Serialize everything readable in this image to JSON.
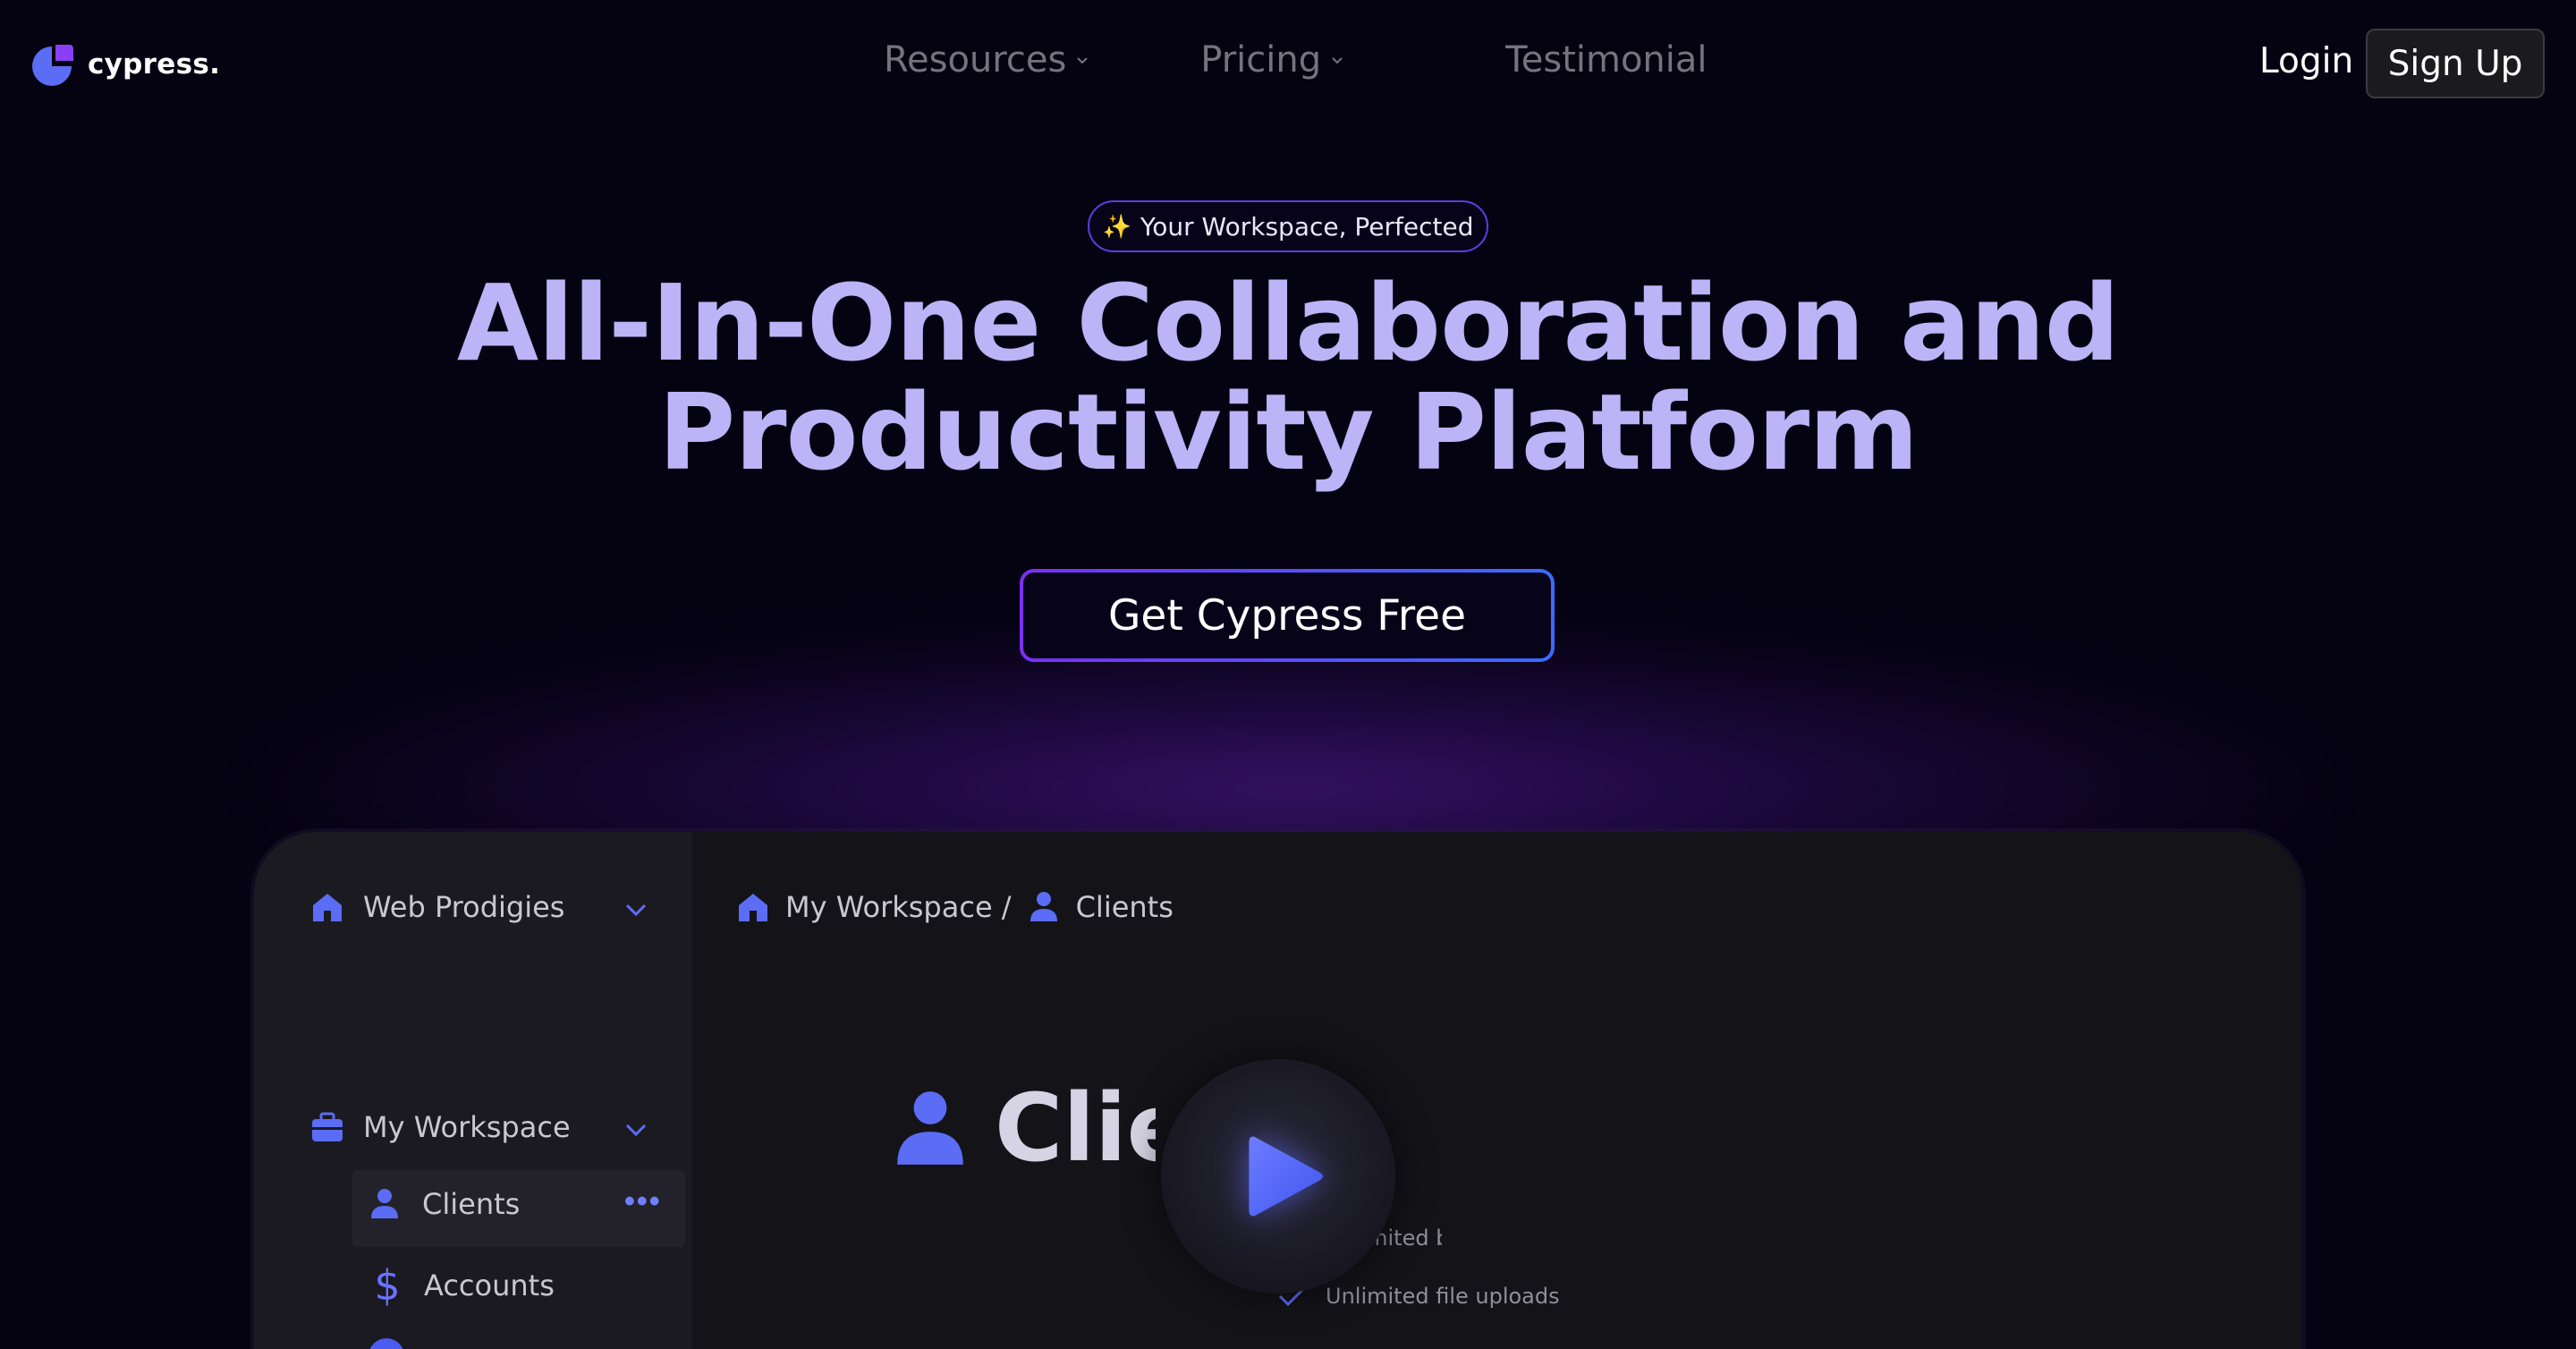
{
  "nav": {
    "logo_text": "cypress.",
    "links": [
      {
        "label": "Resources",
        "has_dropdown": true
      },
      {
        "label": "Pricing",
        "has_dropdown": true
      },
      {
        "label": "Testimonial",
        "has_dropdown": false
      }
    ],
    "login_label": "Login",
    "signup_label": "Sign Up"
  },
  "hero": {
    "badge_icon": "sparkles-icon",
    "badge_text": "Your Workspace, Perfected",
    "title_line1": "All-In-One Collaboration and",
    "title_line2": "Productivity Platform",
    "cta_label": "Get Cypress Free"
  },
  "preview": {
    "sidebar": {
      "workspace_name": "Web Prodigies",
      "folder_name": "My Workspace",
      "items": [
        {
          "label": "Clients",
          "icon": "user-icon",
          "selected": true
        },
        {
          "label": "Accounts",
          "icon": "dollar-icon",
          "selected": false
        }
      ]
    },
    "breadcrumb": {
      "workspace": "My Workspace /",
      "page": "Clients"
    },
    "doc_title": "Clients",
    "features": [
      "Unlimited b",
      "Unlimited file uploads"
    ]
  },
  "colors": {
    "background": "#050312",
    "title": "#bdb3f7",
    "accent_purple": "#7b2ff7",
    "accent_blue": "#3b6bff",
    "icon_blue": "#5b6cf5"
  }
}
